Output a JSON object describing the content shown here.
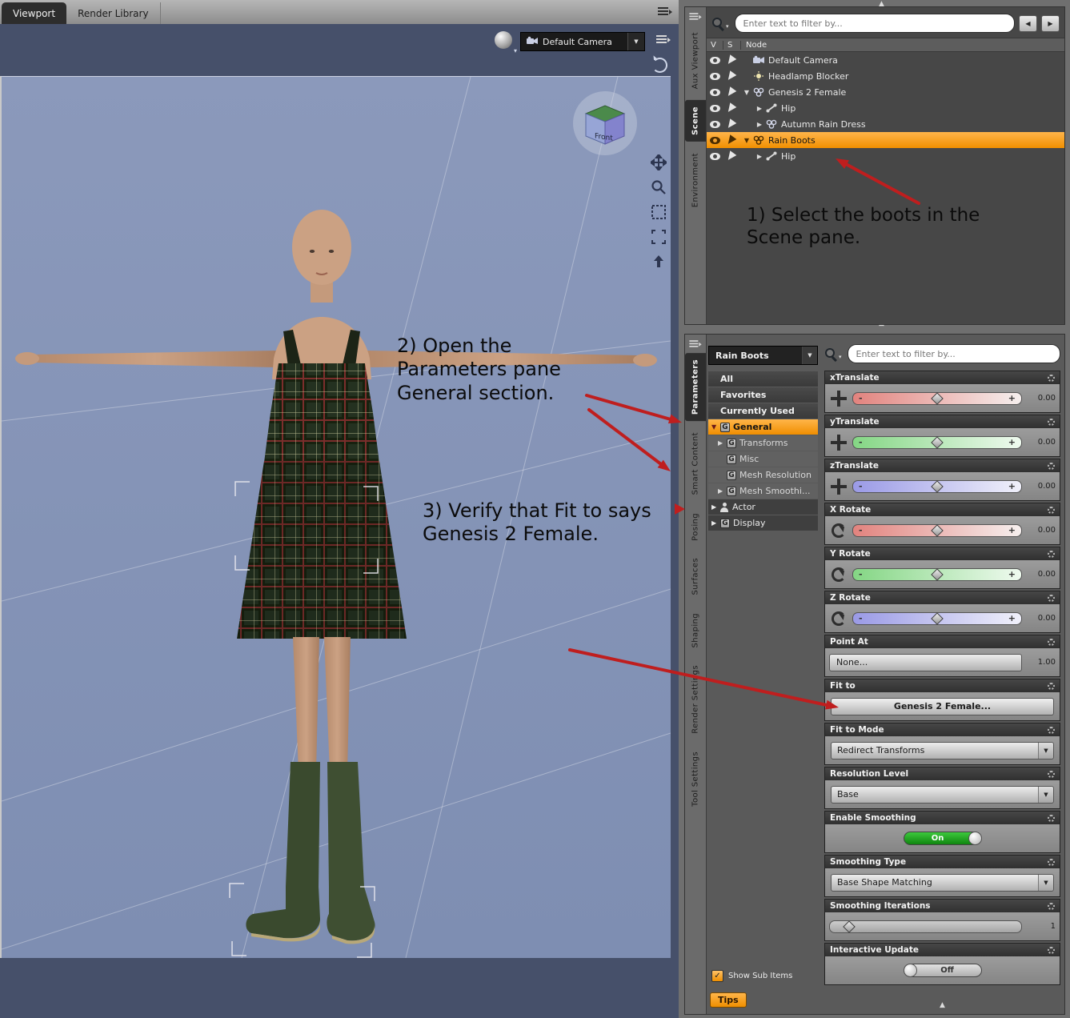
{
  "icons": {
    "menu": "≡",
    "dropdown": "▼",
    "dropdown_small": "▾",
    "nav_left": "◀",
    "nav_right": "▶",
    "collapse_up": "▲",
    "minus": "-",
    "plus": "+",
    "check": "✓"
  },
  "colors": {
    "selection_orange": "#f7941d",
    "x_axis_track": "#e2837e",
    "y_axis_track": "#84d684",
    "z_axis_track": "#9a9ae6",
    "toggle_on_green": "#1faa1f",
    "annotation_arrow_red": "#bf1e1e",
    "viewport_background": "#8593b6"
  },
  "viewport": {
    "tabs": [
      {
        "label": "Viewport"
      },
      {
        "label": "Render Library"
      }
    ],
    "camera": {
      "label": "Default Camera"
    },
    "view_cube_label": "Front",
    "annotation_step2": "2) Open the\nParameters pane\nGeneral section.",
    "annotation_step3": "3) Verify that Fit to says\nGenesis 2 Female."
  },
  "scene": {
    "tabs": [
      {
        "label": "Aux Viewport"
      },
      {
        "label": "Scene"
      },
      {
        "label": "Environment"
      }
    ],
    "filter_placeholder": "Enter text to filter by...",
    "columns": {
      "v": "V",
      "s": "S",
      "node": "Node"
    },
    "nodes": [
      {
        "expand": "",
        "label": "Default Camera"
      },
      {
        "expand": "",
        "label": "Headlamp Blocker"
      },
      {
        "expand": "▼",
        "label": "Genesis 2 Female"
      },
      {
        "expand": "▶",
        "label": "Hip"
      },
      {
        "expand": "▶",
        "label": "Autumn Rain Dress"
      },
      {
        "expand": "▼",
        "label": "Rain Boots"
      },
      {
        "expand": "▶",
        "label": "Hip"
      }
    ],
    "annotation_step1": "1) Select the boots in the\nScene pane."
  },
  "params": {
    "tabs": [
      {
        "label": "Parameters"
      },
      {
        "label": "Smart Content"
      },
      {
        "label": "Posing"
      },
      {
        "label": "Surfaces"
      },
      {
        "label": "Shaping"
      },
      {
        "label": "Render Settings"
      },
      {
        "label": "Tool Settings"
      }
    ],
    "node_selector": "Rain Boots",
    "filter_placeholder": "Enter text to filter by...",
    "categories": [
      {
        "label": "All",
        "expand": ""
      },
      {
        "label": "Favorites",
        "expand": ""
      },
      {
        "label": "Currently Used",
        "expand": ""
      },
      {
        "label": "General",
        "expand": "▼"
      },
      {
        "label": "Transforms",
        "expand": "▶"
      },
      {
        "label": "Misc",
        "expand": ""
      },
      {
        "label": "Mesh Resolution",
        "expand": ""
      },
      {
        "label": "Mesh Smoothi...",
        "expand": "▶"
      },
      {
        "label": "Actor",
        "expand": "▶"
      },
      {
        "label": "Display",
        "expand": "▶"
      }
    ],
    "sliders": [
      {
        "label": "xTranslate",
        "value": "0.00"
      },
      {
        "label": "yTranslate",
        "value": "0.00"
      },
      {
        "label": "zTranslate",
        "value": "0.00"
      },
      {
        "label": "X Rotate",
        "value": "0.00"
      },
      {
        "label": "Y Rotate",
        "value": "0.00"
      },
      {
        "label": "Z Rotate",
        "value": "0.00"
      }
    ],
    "point_at": {
      "label": "Point At",
      "button": "None...",
      "value": "1.00"
    },
    "fit_to": {
      "label": "Fit to",
      "value": "Genesis 2 Female..."
    },
    "fit_to_mode": {
      "label": "Fit to Mode",
      "value": "Redirect Transforms"
    },
    "resolution_level": {
      "label": "Resolution Level",
      "value": "Base"
    },
    "enable_smoothing": {
      "label": "Enable Smoothing",
      "state": "On"
    },
    "smoothing_type": {
      "label": "Smoothing Type",
      "value": "Base Shape Matching"
    },
    "smoothing_iterations": {
      "label": "Smoothing Iterations",
      "value": "1"
    },
    "interactive_update": {
      "label": "Interactive Update",
      "state": "Off"
    },
    "show_sub_items": "Show Sub Items",
    "tips": "Tips"
  }
}
